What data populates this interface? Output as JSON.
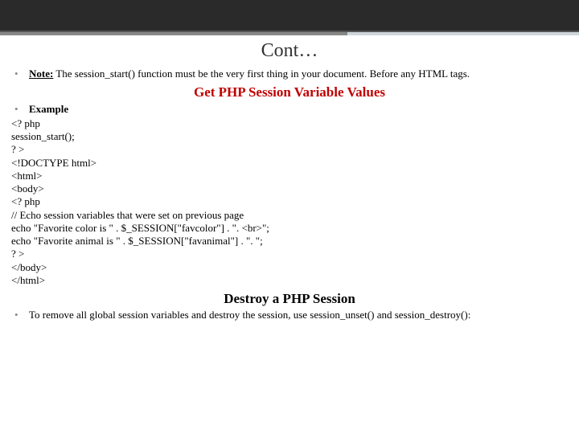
{
  "title": "Cont…",
  "note": {
    "label": "Note:",
    "text": " The session_start() function must be the very first thing in your document. Before any HTML tags."
  },
  "section1_heading": "Get PHP Session Variable Values",
  "example_label": "Example",
  "code": "<? php\nsession_start();\n? >\n<!DOCTYPE html>\n<html>\n<body>\n<? php\n// Echo session variables that were set on previous page\necho \"Favorite color is \" . $_SESSION[\"favcolor\"] . \". <br>\";\necho \"Favorite animal is \" . $_SESSION[\"favanimal\"] . \". \";\n? >\n</body>\n</html>",
  "section2_heading": "Destroy a PHP Session",
  "destroy_text": "To remove all global session variables and destroy the session, use session_unset() and session_destroy():"
}
